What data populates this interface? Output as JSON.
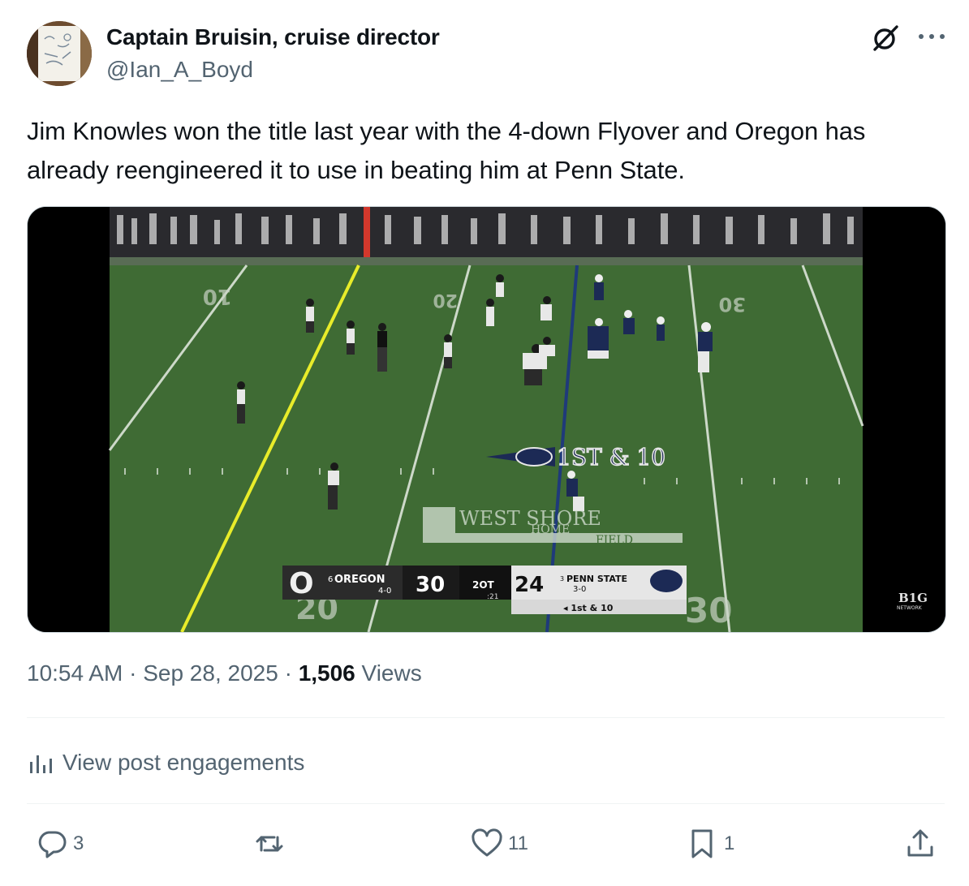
{
  "author": {
    "name": "Captain Bruisin, cruise director",
    "handle": "@Ian_A_Boyd"
  },
  "icons": {
    "grok": "grok-icon",
    "more": "more-icon",
    "engagements": "bar-chart-icon",
    "reply": "reply-icon",
    "repost": "repost-icon",
    "like": "heart-icon",
    "bookmark": "bookmark-icon",
    "share": "share-icon"
  },
  "tweet": {
    "text": "Jim Knowles won the title last year with the 4-down Flyover and Oregon has already reengineered it to use in beating him at Penn State."
  },
  "media": {
    "scorebug": {
      "away_rank": "6",
      "away_team": "OREGON",
      "away_record": "4-0",
      "away_score": "30",
      "period": "2OT",
      "clock": ":21",
      "home_score": "24",
      "home_rank": "3",
      "home_team": "PENN STATE",
      "home_record": "3-0",
      "down_distance": "◂ 1st & 10"
    },
    "field_graphic": "1ST & 10",
    "field_sponsor_line1": "WEST SHORE",
    "field_sponsor_line2": "HOME",
    "field_sponsor_line3": "FIELD",
    "field_numbers": [
      "10",
      "20",
      "30",
      "20",
      "30"
    ],
    "network_logo": "B1G",
    "network_sub": "NETWORK"
  },
  "meta": {
    "time": "10:54 AM",
    "sep1": " · ",
    "date": "Sep 28, 2025",
    "sep2": " · ",
    "views_count": "1,506",
    "views_label": " Views"
  },
  "engagements_label": "View post engagements",
  "actions": {
    "replies": "3",
    "reposts": "",
    "likes": "11",
    "bookmarks": "1"
  },
  "colors": {
    "text_primary": "#0f1419",
    "text_secondary": "#536471",
    "divider": "#eff3f4",
    "field_green": "#3f6b34"
  }
}
